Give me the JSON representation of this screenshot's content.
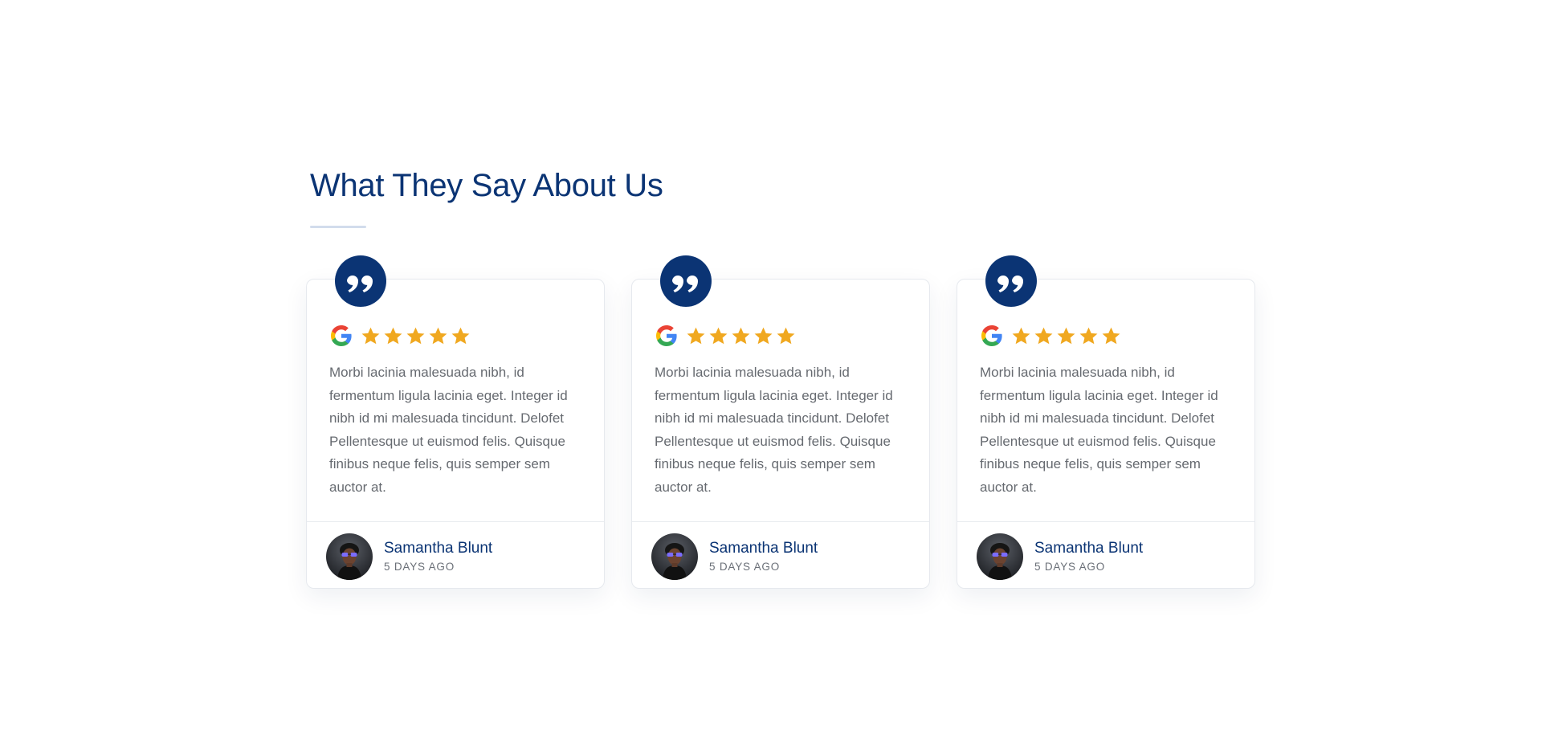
{
  "section": {
    "title": "What They Say About Us"
  },
  "colors": {
    "navy": "#0b3474",
    "star_gold": "#f0a820",
    "body_text": "#666a70",
    "underline": "#d2dcec"
  },
  "icons": {
    "quote": "quote-icon",
    "google": "google-icon",
    "star": "star-icon",
    "avatar": "avatar"
  },
  "reviews": [
    {
      "rating": 5,
      "text": "Morbi lacinia malesuada nibh, id fermentum ligula lacinia eget. Integer id nibh id mi malesuada tincidunt. Delofet Pellentesque ut euismod felis. Quisque finibus neque felis, quis semper sem auctor at.",
      "author_name": "Samantha Blunt",
      "date": "5 DAYS AGO"
    },
    {
      "rating": 5,
      "text": "Morbi lacinia malesuada nibh, id fermentum ligula lacinia eget. Integer id nibh id mi malesuada tincidunt. Delofet Pellentesque ut euismod felis. Quisque finibus neque felis, quis semper sem auctor at.",
      "author_name": "Samantha Blunt",
      "date": "5 DAYS AGO"
    },
    {
      "rating": 5,
      "text": "Morbi lacinia malesuada nibh, id fermentum ligula lacinia eget. Integer id nibh id mi malesuada tincidunt. Delofet Pellentesque ut euismod felis. Quisque finibus neque felis, quis semper sem auctor at.",
      "author_name": "Samantha Blunt",
      "date": "5 DAYS AGO"
    }
  ]
}
